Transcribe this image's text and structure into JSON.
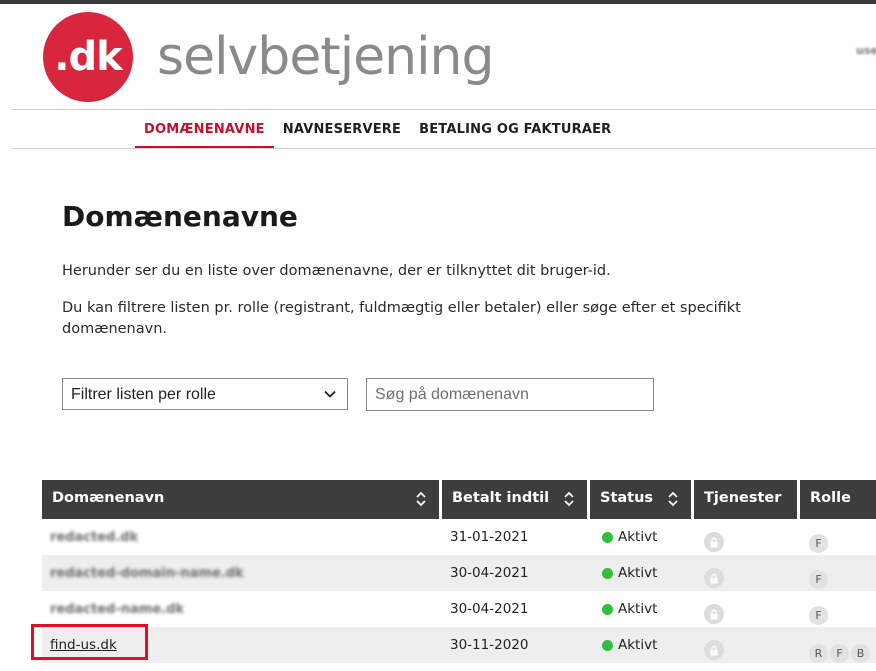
{
  "header": {
    "logo_text": ".dk",
    "app_title": "selvbetjening",
    "user_redacted": "user-id"
  },
  "nav": {
    "items": [
      {
        "label": "DOMÆNENAVNE",
        "active": true
      },
      {
        "label": "NAVNESERVERE",
        "active": false
      },
      {
        "label": "BETALING OG FAKTURAER",
        "active": false
      }
    ]
  },
  "main": {
    "title": "Domænenavne",
    "intro": "Herunder ser du en liste over domænenavne, der er tilknyttet dit bruger-id.",
    "filter_help": "Du kan filtrere listen pr. rolle (registrant, fuldmægtig eller betaler) eller søge efter et specifikt domænenavn."
  },
  "filters": {
    "role_select_value": "Filtrer listen per rolle",
    "search_placeholder": "Søg på domænenavn"
  },
  "table": {
    "headers": {
      "domain": "Domænenavn",
      "paid_until": "Betalt indtil",
      "status": "Status",
      "services": "Tjenester",
      "role": "Rolle"
    },
    "rows": [
      {
        "domain": "redacted.dk",
        "paid_until": "31-01-2021",
        "status": "Aktivt",
        "roles": [
          "F"
        ]
      },
      {
        "domain": "redacted-domain-name.dk",
        "paid_until": "30-04-2021",
        "status": "Aktivt",
        "roles": [
          "F"
        ]
      },
      {
        "domain": "redacted-name.dk",
        "paid_until": "30-04-2021",
        "status": "Aktivt",
        "roles": [
          "F"
        ]
      },
      {
        "domain": "find-us.dk",
        "paid_until": "30-11-2020",
        "status": "Aktivt",
        "roles": [
          "R",
          "F",
          "B"
        ]
      }
    ]
  },
  "colors": {
    "brand_red": "#d7263d",
    "active_nav": "#c8102e",
    "status_green": "#2fbf3a",
    "table_header_bg": "#3d3d3d",
    "highlight_border": "#e0102a"
  }
}
